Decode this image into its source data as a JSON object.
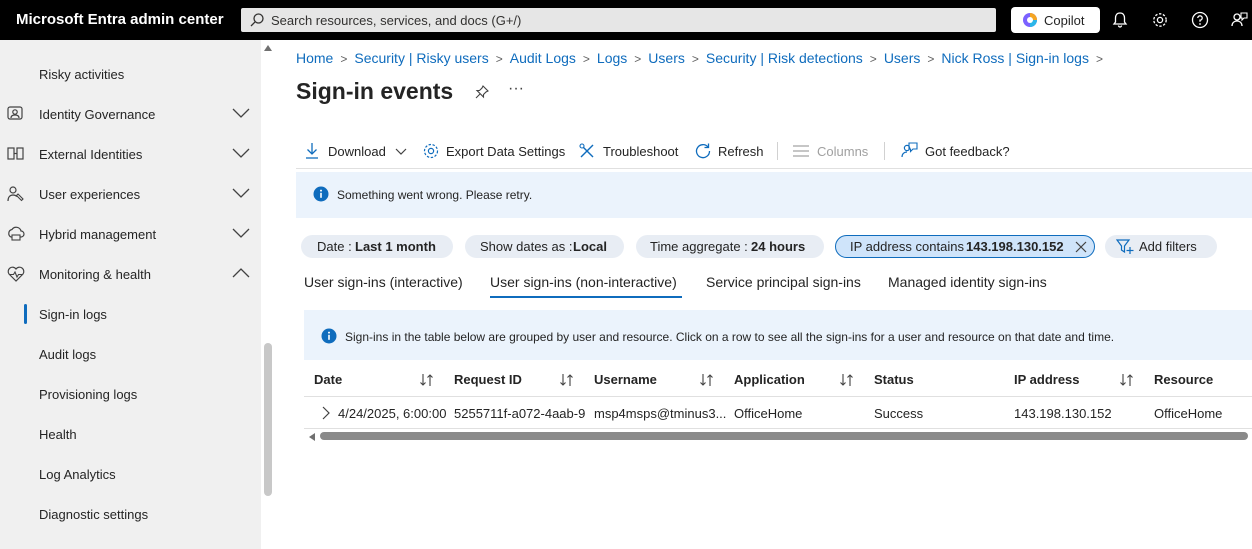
{
  "app": {
    "title": "Microsoft Entra admin center"
  },
  "search": {
    "placeholder": "Search resources, services, and docs (G+/)"
  },
  "copilot": {
    "label": "Copilot"
  },
  "topbar_icons": [
    "bell-icon",
    "gear-icon",
    "help-icon",
    "feedback-person-icon"
  ],
  "sidebar": {
    "items": [
      {
        "label": "Risky activities",
        "icon": ""
      },
      {
        "label": "Identity Governance",
        "icon": "identity-governance-icon",
        "chevron": "down"
      },
      {
        "label": "External Identities",
        "icon": "external-identities-icon",
        "chevron": "down"
      },
      {
        "label": "User experiences",
        "icon": "user-experiences-icon",
        "chevron": "down"
      },
      {
        "label": "Hybrid management",
        "icon": "hybrid-management-icon",
        "chevron": "down"
      },
      {
        "label": "Monitoring & health",
        "icon": "heart-icon",
        "chevron": "up"
      },
      {
        "label": "Sign-in logs",
        "active": true
      },
      {
        "label": "Audit logs"
      },
      {
        "label": "Provisioning logs"
      },
      {
        "label": "Health"
      },
      {
        "label": "Log Analytics"
      },
      {
        "label": "Diagnostic settings"
      }
    ]
  },
  "breadcrumb": [
    "Home",
    "Security | Risky users",
    "Audit Logs",
    "Logs",
    "Users",
    "Security | Risk detections",
    "Users",
    "Nick Ross | Sign-in logs"
  ],
  "page": {
    "title": "Sign-in events"
  },
  "toolbar": {
    "download": "Download",
    "export": "Export Data Settings",
    "troubleshoot": "Troubleshoot",
    "refresh": "Refresh",
    "columns": "Columns",
    "feedback": "Got feedback?"
  },
  "alert": {
    "message": "Something went wrong. Please retry."
  },
  "filters": [
    {
      "key": "Date : ",
      "value": "Last 1 month"
    },
    {
      "key": "Show dates as : ",
      "value": "Local"
    },
    {
      "key": "Time aggregate : ",
      "value": "24 hours"
    },
    {
      "key": "IP address contains ",
      "value": "143.198.130.152"
    }
  ],
  "add_filters": "Add filters",
  "tabs": [
    "User sign-ins (interactive)",
    "User sign-ins (non-interactive)",
    "Service principal sign-ins",
    "Managed identity sign-ins"
  ],
  "active_tab": "User sign-ins (non-interactive)",
  "info": {
    "message": "Sign-ins in the table below are grouped by user and resource. Click on a row to see all the sign-ins for a user and resource on that date and time."
  },
  "table": {
    "columns": [
      "Date",
      "Request ID",
      "Username",
      "Application",
      "Status",
      "IP address",
      "Resource"
    ],
    "rows": [
      [
        "4/24/2025, 6:00:00",
        "5255711f-a072-4aab-9",
        "msp4msps@tminus3...",
        "OfficeHome",
        "Success",
        "143.198.130.152",
        "OfficeHome"
      ]
    ]
  },
  "colors": {
    "accent": "#0f6cbd",
    "topbar": "#000000",
    "sidebar": "#f0f0f0",
    "info_bg": "#ebf3fc"
  }
}
